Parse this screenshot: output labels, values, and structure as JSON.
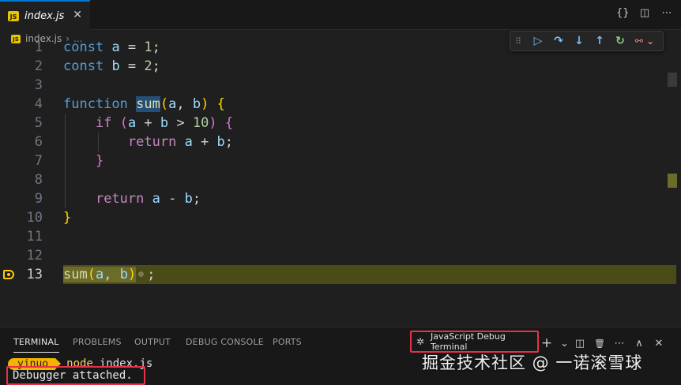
{
  "tab": {
    "badge": "JS",
    "title": "index.js",
    "close": "✕"
  },
  "editor_actions": {
    "braces": "{}",
    "split": "◫",
    "more": "⋯"
  },
  "breadcrumb": {
    "badge": "JS",
    "file": "index.js",
    "separator": "›",
    "more": "..."
  },
  "debug_toolbar": {
    "grip": "⠿",
    "buttons": [
      "continue",
      "step-over",
      "step-into",
      "step-out",
      "restart",
      "disconnect"
    ],
    "glyphs": {
      "continue": "▷",
      "step_over": "↷",
      "step_into": "↓",
      "step_out": "↑",
      "restart": "↻",
      "disconnect": "⚯ ⌄"
    }
  },
  "code_lines": [
    {
      "n": "1",
      "text": "const a = 1;"
    },
    {
      "n": "2",
      "text": "const b = 2;"
    },
    {
      "n": "3",
      "text": ""
    },
    {
      "n": "4",
      "text": "function sum(a, b) {"
    },
    {
      "n": "5",
      "text": "    if (a + b > 10) {"
    },
    {
      "n": "6",
      "text": "        return a + b;"
    },
    {
      "n": "7",
      "text": "    }"
    },
    {
      "n": "8",
      "text": ""
    },
    {
      "n": "9",
      "text": "    return a - b;"
    },
    {
      "n": "10",
      "text": "}"
    },
    {
      "n": "11",
      "text": ""
    },
    {
      "n": "12",
      "text": ""
    },
    {
      "n": "13",
      "text": "sum(a, b) ;"
    }
  ],
  "current_line": "13",
  "panel": {
    "tabs": [
      "TERMINAL",
      "PROBLEMS",
      "OUTPUT",
      "DEBUG CONSOLE",
      "PORTS"
    ],
    "active_tab": "TERMINAL",
    "terminal_selector": "JavaScript Debug Terminal",
    "actions": {
      "add": "+",
      "dropdown": "⌄",
      "split": "◫",
      "trash": "🗑",
      "more": "⋯",
      "maximize": "∧",
      "close": "✕"
    }
  },
  "terminal": {
    "prompt_user": "yinuo",
    "command": "node",
    "argument": "index.js",
    "output": "Debugger attached."
  },
  "watermark": "掘金技术社区 @ 一诺滚雪球",
  "colors": {
    "accent": "#0078d4",
    "highlight_box": "#e8304a",
    "current_line": "#4b4b18",
    "prompt": "#f4b400"
  }
}
